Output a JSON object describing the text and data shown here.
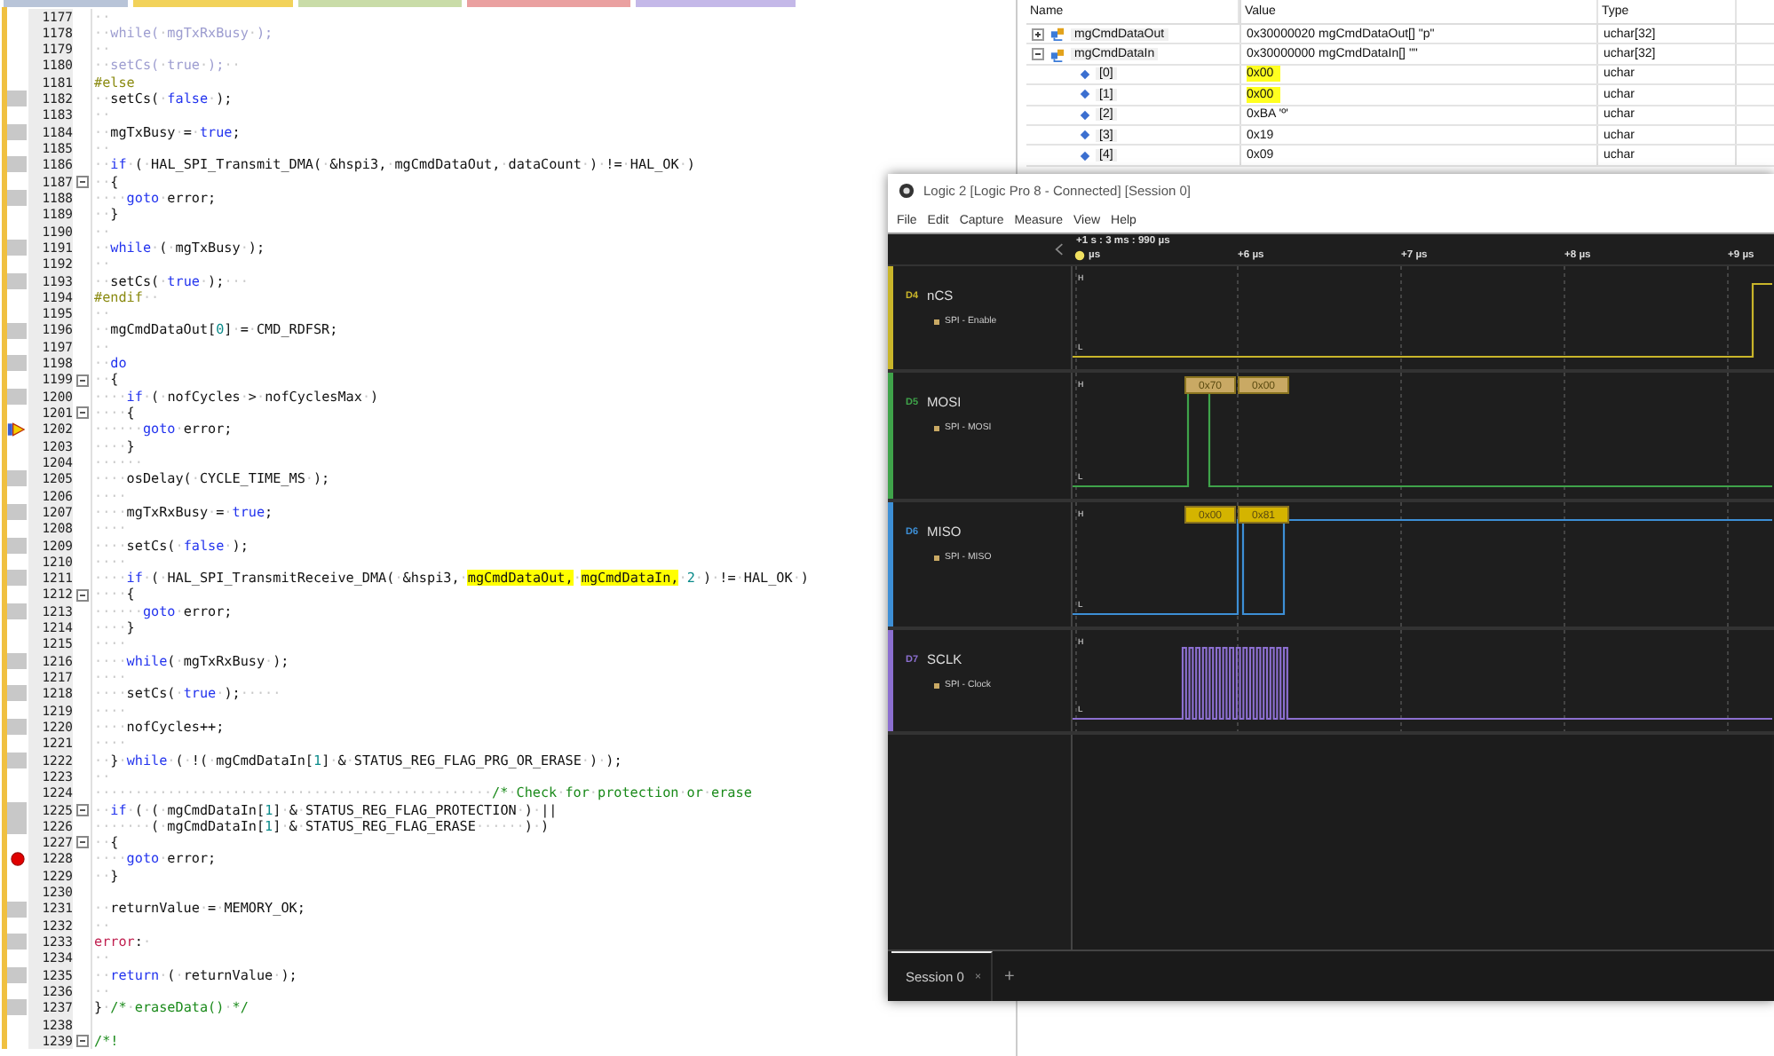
{
  "code": {
    "lines": [
      {
        "num": "1177",
        "kind": "none",
        "fold": false,
        "segments": [
          {
            "kind": "plain",
            "text": "··"
          }
        ]
      },
      {
        "num": "1178",
        "kind": "none",
        "fold": false,
        "segments": [
          {
            "kind": "inactive",
            "text": "··while(·mgTxRxBusy·);"
          }
        ]
      },
      {
        "num": "1179",
        "kind": "none",
        "fold": false,
        "segments": [
          {
            "kind": "plain",
            "text": "··"
          }
        ]
      },
      {
        "num": "1180",
        "kind": "none",
        "fold": false,
        "segments": [
          {
            "kind": "inactive",
            "text": "··setCs(·true·);··"
          }
        ]
      },
      {
        "num": "1181",
        "kind": "none",
        "fold": false,
        "segments": [
          {
            "kind": "preproc",
            "text": "#else"
          }
        ]
      },
      {
        "num": "1182",
        "kind": "bar",
        "fold": false,
        "segments": [
          {
            "kind": "plain",
            "text": "··setCs(·"
          },
          {
            "kind": "keyword",
            "text": "false"
          },
          {
            "kind": "plain",
            "text": "·);"
          }
        ]
      },
      {
        "num": "1183",
        "kind": "none",
        "fold": false,
        "segments": [
          {
            "kind": "plain",
            "text": "··"
          }
        ]
      },
      {
        "num": "1184",
        "kind": "bar",
        "fold": false,
        "segments": [
          {
            "kind": "plain",
            "text": "··mgTxBusy·=·"
          },
          {
            "kind": "keyword",
            "text": "true"
          },
          {
            "kind": "plain",
            "text": ";"
          }
        ]
      },
      {
        "num": "1185",
        "kind": "none",
        "fold": false,
        "segments": [
          {
            "kind": "plain",
            "text": "··"
          }
        ]
      },
      {
        "num": "1186",
        "kind": "bar",
        "fold": false,
        "segments": [
          {
            "kind": "plain",
            "text": "··"
          },
          {
            "kind": "keyword",
            "text": "if"
          },
          {
            "kind": "plain",
            "text": "·(·HAL_SPI_Transmit_DMA(·&hspi3,·mgCmdDataOut,·dataCount·)·!=·HAL_OK·)"
          }
        ]
      },
      {
        "num": "1187",
        "kind": "none",
        "fold": true,
        "segments": [
          {
            "kind": "plain",
            "text": "··{"
          }
        ]
      },
      {
        "num": "1188",
        "kind": "bar",
        "fold": false,
        "segments": [
          {
            "kind": "plain",
            "text": "····"
          },
          {
            "kind": "keyword",
            "text": "goto"
          },
          {
            "kind": "plain",
            "text": "·error;"
          }
        ]
      },
      {
        "num": "1189",
        "kind": "none",
        "fold": false,
        "segments": [
          {
            "kind": "plain",
            "text": "··}"
          }
        ]
      },
      {
        "num": "1190",
        "kind": "none",
        "fold": false,
        "segments": [
          {
            "kind": "plain",
            "text": "··"
          }
        ]
      },
      {
        "num": "1191",
        "kind": "bar",
        "fold": false,
        "segments": [
          {
            "kind": "plain",
            "text": "··"
          },
          {
            "kind": "keyword",
            "text": "while"
          },
          {
            "kind": "plain",
            "text": "·(·mgTxBusy·);"
          }
        ]
      },
      {
        "num": "1192",
        "kind": "none",
        "fold": false,
        "segments": [
          {
            "kind": "plain",
            "text": "··"
          }
        ]
      },
      {
        "num": "1193",
        "kind": "bar",
        "fold": false,
        "segments": [
          {
            "kind": "plain",
            "text": "··setCs(·"
          },
          {
            "kind": "keyword",
            "text": "true"
          },
          {
            "kind": "plain",
            "text": "·);···"
          }
        ]
      },
      {
        "num": "1194",
        "kind": "none",
        "fold": false,
        "segments": [
          {
            "kind": "preproc",
            "text": "#endif··"
          }
        ]
      },
      {
        "num": "1195",
        "kind": "none",
        "fold": false,
        "segments": [
          {
            "kind": "plain",
            "text": "··"
          }
        ]
      },
      {
        "num": "1196",
        "kind": "bar",
        "fold": false,
        "segments": [
          {
            "kind": "plain",
            "text": "··mgCmdDataOut["
          },
          {
            "kind": "number",
            "text": "0"
          },
          {
            "kind": "plain",
            "text": "]·=·CMD_RDFSR;"
          }
        ]
      },
      {
        "num": "1197",
        "kind": "none",
        "fold": false,
        "segments": [
          {
            "kind": "plain",
            "text": "··"
          }
        ]
      },
      {
        "num": "1198",
        "kind": "bar",
        "fold": false,
        "segments": [
          {
            "kind": "plain",
            "text": "··"
          },
          {
            "kind": "keyword",
            "text": "do"
          }
        ]
      },
      {
        "num": "1199",
        "kind": "none",
        "fold": true,
        "segments": [
          {
            "kind": "plain",
            "text": "··{"
          }
        ]
      },
      {
        "num": "1200",
        "kind": "bar",
        "fold": false,
        "segments": [
          {
            "kind": "plain",
            "text": "····"
          },
          {
            "kind": "keyword",
            "text": "if"
          },
          {
            "kind": "plain",
            "text": "·(·nofCycles·>·nofCyclesMax·)"
          }
        ]
      },
      {
        "num": "1201",
        "kind": "none",
        "fold": true,
        "segments": [
          {
            "kind": "plain",
            "text": "····{"
          }
        ]
      },
      {
        "num": "1202",
        "kind": "current",
        "fold": false,
        "segments": [
          {
            "kind": "plain",
            "text": "······"
          },
          {
            "kind": "keyword",
            "text": "goto"
          },
          {
            "kind": "plain",
            "text": "·error;"
          }
        ]
      },
      {
        "num": "1203",
        "kind": "none",
        "fold": false,
        "segments": [
          {
            "kind": "plain",
            "text": "····}"
          }
        ]
      },
      {
        "num": "1204",
        "kind": "none",
        "fold": false,
        "segments": [
          {
            "kind": "plain",
            "text": "······"
          }
        ]
      },
      {
        "num": "1205",
        "kind": "bar",
        "fold": false,
        "segments": [
          {
            "kind": "plain",
            "text": "····osDelay(·CYCLE_TIME_MS·);"
          }
        ]
      },
      {
        "num": "1206",
        "kind": "none",
        "fold": false,
        "segments": [
          {
            "kind": "plain",
            "text": "····"
          }
        ]
      },
      {
        "num": "1207",
        "kind": "bar",
        "fold": false,
        "segments": [
          {
            "kind": "plain",
            "text": "····mgTxRxBusy·=·"
          },
          {
            "kind": "keyword",
            "text": "true"
          },
          {
            "kind": "plain",
            "text": ";"
          }
        ]
      },
      {
        "num": "1208",
        "kind": "none",
        "fold": false,
        "segments": [
          {
            "kind": "plain",
            "text": "····"
          }
        ]
      },
      {
        "num": "1209",
        "kind": "bar",
        "fold": false,
        "segments": [
          {
            "kind": "plain",
            "text": "····setCs(·"
          },
          {
            "kind": "keyword",
            "text": "false"
          },
          {
            "kind": "plain",
            "text": "·);"
          }
        ]
      },
      {
        "num": "1210",
        "kind": "none",
        "fold": false,
        "segments": [
          {
            "kind": "plain",
            "text": "····"
          }
        ]
      },
      {
        "num": "1211",
        "kind": "bar",
        "fold": false,
        "segments": [
          {
            "kind": "plain",
            "text": "····"
          },
          {
            "kind": "keyword",
            "text": "if"
          },
          {
            "kind": "plain",
            "text": "·(·HAL_SPI_TransmitReceive_DMA(·&hspi3,·"
          },
          {
            "kind": "highlight",
            "text": "mgCmdDataOut,"
          },
          {
            "kind": "plain",
            "text": "·"
          },
          {
            "kind": "highlight",
            "text": "mgCmdDataIn,"
          },
          {
            "kind": "plain",
            "text": "·"
          },
          {
            "kind": "number",
            "text": "2"
          },
          {
            "kind": "plain",
            "text": "·)·!=·HAL_OK·)"
          }
        ]
      },
      {
        "num": "1212",
        "kind": "none",
        "fold": true,
        "segments": [
          {
            "kind": "plain",
            "text": "····{"
          }
        ]
      },
      {
        "num": "1213",
        "kind": "bar",
        "fold": false,
        "segments": [
          {
            "kind": "plain",
            "text": "······"
          },
          {
            "kind": "keyword",
            "text": "goto"
          },
          {
            "kind": "plain",
            "text": "·error;"
          }
        ]
      },
      {
        "num": "1214",
        "kind": "none",
        "fold": false,
        "segments": [
          {
            "kind": "plain",
            "text": "····}"
          }
        ]
      },
      {
        "num": "1215",
        "kind": "none",
        "fold": false,
        "segments": [
          {
            "kind": "plain",
            "text": "····"
          }
        ]
      },
      {
        "num": "1216",
        "kind": "bar",
        "fold": false,
        "segments": [
          {
            "kind": "plain",
            "text": "····"
          },
          {
            "kind": "keyword",
            "text": "while"
          },
          {
            "kind": "plain",
            "text": "(·mgTxRxBusy·);"
          }
        ]
      },
      {
        "num": "1217",
        "kind": "none",
        "fold": false,
        "segments": [
          {
            "kind": "plain",
            "text": "····"
          }
        ]
      },
      {
        "num": "1218",
        "kind": "bar",
        "fold": false,
        "segments": [
          {
            "kind": "plain",
            "text": "····setCs(·"
          },
          {
            "kind": "keyword",
            "text": "true"
          },
          {
            "kind": "plain",
            "text": "·);·····"
          }
        ]
      },
      {
        "num": "1219",
        "kind": "none",
        "fold": false,
        "segments": [
          {
            "kind": "plain",
            "text": "····"
          }
        ]
      },
      {
        "num": "1220",
        "kind": "bar",
        "fold": false,
        "segments": [
          {
            "kind": "plain",
            "text": "····nofCycles++;"
          }
        ]
      },
      {
        "num": "1221",
        "kind": "none",
        "fold": false,
        "segments": [
          {
            "kind": "plain",
            "text": "····"
          }
        ]
      },
      {
        "num": "1222",
        "kind": "bar",
        "fold": false,
        "segments": [
          {
            "kind": "plain",
            "text": "··}·"
          },
          {
            "kind": "keyword",
            "text": "while"
          },
          {
            "kind": "plain",
            "text": "·(·!(·mgCmdDataIn["
          },
          {
            "kind": "number",
            "text": "1"
          },
          {
            "kind": "plain",
            "text": "]·&·STATUS_REG_FLAG_PRG_OR_ERASE·)·);"
          }
        ]
      },
      {
        "num": "1223",
        "kind": "none",
        "fold": false,
        "segments": [
          {
            "kind": "plain",
            "text": "··"
          }
        ]
      },
      {
        "num": "1224",
        "kind": "none",
        "fold": false,
        "segments": [
          {
            "kind": "plain",
            "text": "·················································"
          },
          {
            "kind": "comment",
            "text": "/*·Check·for·protection·or·erase"
          }
        ]
      },
      {
        "num": "1225",
        "kind": "bar",
        "fold": true,
        "segments": [
          {
            "kind": "plain",
            "text": "··"
          },
          {
            "kind": "keyword",
            "text": "if"
          },
          {
            "kind": "plain",
            "text": "·(·(·mgCmdDataIn["
          },
          {
            "kind": "number",
            "text": "1"
          },
          {
            "kind": "plain",
            "text": "]·&·STATUS_REG_FLAG_PROTECTION·)·||"
          }
        ]
      },
      {
        "num": "1226",
        "kind": "bar",
        "fold": false,
        "segments": [
          {
            "kind": "plain",
            "text": "·······(·mgCmdDataIn["
          },
          {
            "kind": "number",
            "text": "1"
          },
          {
            "kind": "plain",
            "text": "]·&·STATUS_REG_FLAG_ERASE······)·)"
          }
        ]
      },
      {
        "num": "1227",
        "kind": "none",
        "fold": true,
        "segments": [
          {
            "kind": "plain",
            "text": "··{"
          }
        ]
      },
      {
        "num": "1228",
        "kind": "breakpoint",
        "fold": false,
        "segments": [
          {
            "kind": "plain",
            "text": "····"
          },
          {
            "kind": "keyword",
            "text": "goto"
          },
          {
            "kind": "plain",
            "text": "·error;"
          }
        ]
      },
      {
        "num": "1229",
        "kind": "none",
        "fold": false,
        "segments": [
          {
            "kind": "plain",
            "text": "··}"
          }
        ]
      },
      {
        "num": "1230",
        "kind": "none",
        "fold": false
      },
      {
        "num": "1231",
        "kind": "bar",
        "fold": false,
        "segments": [
          {
            "kind": "plain",
            "text": "··returnValue·=·MEMORY_OK;"
          }
        ]
      },
      {
        "num": "1232",
        "kind": "none",
        "fold": false,
        "segments": [
          {
            "kind": "plain",
            "text": "··"
          }
        ]
      },
      {
        "num": "1233",
        "kind": "bar",
        "fold": false,
        "segments": [
          {
            "kind": "label",
            "text": "error"
          },
          {
            "kind": "plain",
            "text": ":·"
          }
        ]
      },
      {
        "num": "1234",
        "kind": "none",
        "fold": false,
        "segments": [
          {
            "kind": "plain",
            "text": "··"
          }
        ]
      },
      {
        "num": "1235",
        "kind": "bar",
        "fold": false,
        "segments": [
          {
            "kind": "plain",
            "text": "··"
          },
          {
            "kind": "keyword",
            "text": "return"
          },
          {
            "kind": "plain",
            "text": "·(·returnValue·);"
          }
        ]
      },
      {
        "num": "1236",
        "kind": "none",
        "fold": false,
        "segments": [
          {
            "kind": "plain",
            "text": "··"
          }
        ]
      },
      {
        "num": "1237",
        "kind": "bar",
        "fold": false,
        "segments": [
          {
            "kind": "plain",
            "text": "}·"
          },
          {
            "kind": "comment",
            "text": "/*·eraseData()·*/"
          }
        ]
      },
      {
        "num": "1238",
        "kind": "none",
        "fold": false
      },
      {
        "num": "1239",
        "kind": "none",
        "fold": true,
        "segments": [
          {
            "kind": "comment",
            "text": "/*!"
          }
        ]
      }
    ]
  },
  "watch": {
    "columns": [
      "Name",
      "Value",
      "Type"
    ],
    "rows": [
      {
        "name": "mgCmdDataOut",
        "value": "0x30000020 mgCmdDataOut[] \"p\"",
        "type": "uchar[32]",
        "expanded": false
      },
      {
        "name": "mgCmdDataIn",
        "value": "0x30000000 mgCmdDataIn[] \"\"",
        "type": "uchar[32]",
        "expanded": true,
        "children": [
          {
            "name": "[0]",
            "value": "0x00",
            "type": "uchar",
            "highlighted": true
          },
          {
            "name": "[1]",
            "value": "0x00",
            "type": "uchar",
            "highlighted": true
          },
          {
            "name": "[2]",
            "value": "0xBA 'º'",
            "type": "uchar",
            "highlighted": false
          },
          {
            "name": "[3]",
            "value": "0x19",
            "type": "uchar",
            "highlighted": false
          },
          {
            "name": "[4]",
            "value": "0x09",
            "type": "uchar",
            "highlighted": false
          }
        ]
      }
    ]
  },
  "logic": {
    "title": "Logic 2 [Logic Pro 8 - Connected] [Session 0]",
    "menu": [
      "File",
      "Edit",
      "Capture",
      "Measure",
      "View",
      "Help"
    ],
    "time_origin": "+1 s : 3 ms : 990 µs",
    "ticks": [
      "µs",
      "+6 µs",
      "+7 µs",
      "+8 µs",
      "+9 µs"
    ],
    "channels": [
      {
        "id": "D4",
        "name": "nCS",
        "analyzer": "SPI - Enable",
        "color": "#c9b52a",
        "high": "H",
        "low": "L"
      },
      {
        "id": "D5",
        "name": "MOSI",
        "analyzer": "SPI - MOSI",
        "color": "#3fa34a",
        "high": "H",
        "low": "L",
        "decodes": [
          {
            "label": "0x70",
            "color": "#c9a964"
          },
          {
            "label": "0x00",
            "color": "#c9a964"
          }
        ]
      },
      {
        "id": "D6",
        "name": "MISO",
        "analyzer": "SPI - MISO",
        "color": "#3d8fd6",
        "high": "H",
        "low": "L",
        "decodes": [
          {
            "label": "0x00",
            "color": "#d4b400"
          },
          {
            "label": "0x81",
            "color": "#d4b400"
          }
        ]
      },
      {
        "id": "D7",
        "name": "SCLK",
        "analyzer": "SPI - Clock",
        "color": "#8c6fd0",
        "high": "H",
        "low": "L"
      }
    ],
    "sessions": [
      {
        "label": "Session 0",
        "selected": true,
        "close": "×"
      }
    ],
    "add": "+"
  }
}
